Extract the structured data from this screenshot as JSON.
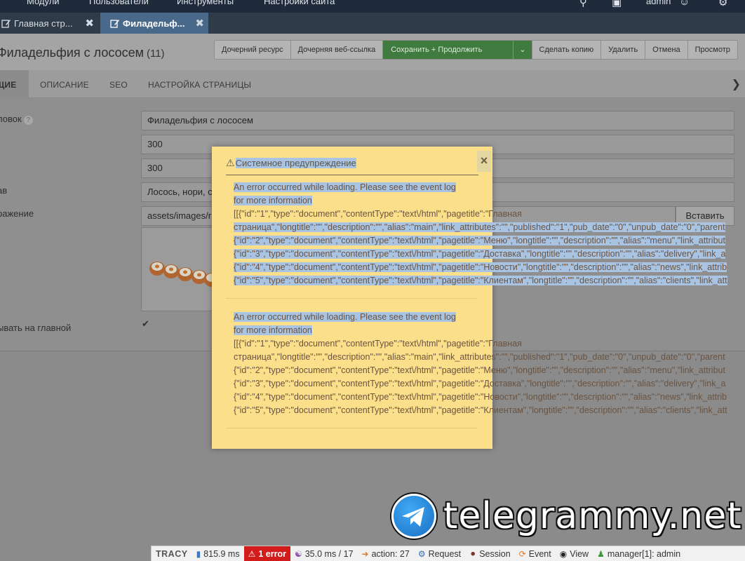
{
  "topnav": {
    "items": [
      "Модули",
      "Пользователи",
      "Инструменты",
      "Настройки сайта"
    ],
    "user": "admin"
  },
  "tabs": [
    {
      "label": "Главная стр...",
      "active": false
    },
    {
      "label": "Филадельф...",
      "active": true
    }
  ],
  "page": {
    "title": "Филадельфия с лососем",
    "count": "(11)"
  },
  "toolbar": {
    "child_resource": "Дочерний ресурс",
    "child_weblink": "Дочерняя веб-ссылка",
    "save_continue": "Сохранить + Продолжить",
    "save_dropdown": "⌄",
    "duplicate": "Сделать копию",
    "delete": "Удалить",
    "cancel": "Отмена",
    "view": "Просмотр"
  },
  "subtabs": {
    "general": "ЩИЕ",
    "description": "ОПИСАНИЕ",
    "seo": "SEO",
    "page_settings": "НАСТРОЙКА СТРАНИЦЫ"
  },
  "form": {
    "title_label": "ловок",
    "title_value": "Филадельфия с лососем",
    "field2_value": "300",
    "field3_value": "300",
    "composition_label": "ав",
    "composition_value": "Лосось, нори, с",
    "image_label": "ражение",
    "image_value": "assets/images/r",
    "insert_button": "Вставить",
    "show_home_label": "ывать на главной"
  },
  "modal": {
    "title": "Системное предупреждение",
    "close": "×",
    "blocks": [
      {
        "lines": [
          "An error occurred while loading. Please see the event log",
          "for more information",
          "[[{\"id\":\"1\",\"type\":\"document\",\"contentType\":\"text\\/html\",\"pagetitle\":\"Главная",
          "страница\",\"longtitle\":\"\",\"description\":\"\",\"alias\":\"main\",\"link_attributes\":\"\",\"published\":\"1\",\"pub_date\":\"0\",\"unpub_date\":\"0\",\"parent",
          "{\"id\":\"2\",\"type\":\"document\",\"contentType\":\"text\\/html\",\"pagetitle\":\"Меню\",\"longtitle\":\"\",\"description\":\"\",\"alias\":\"menu\",\"link_attribut",
          "{\"id\":\"3\",\"type\":\"document\",\"contentType\":\"text\\/html\",\"pagetitle\":\"Доставка\",\"longtitle\":\"\",\"description\":\"\",\"alias\":\"delivery\",\"link_a",
          "{\"id\":\"4\",\"type\":\"document\",\"contentType\":\"text\\/html\",\"pagetitle\":\"Новости\",\"longtitle\":\"\",\"description\":\"\",\"alias\":\"news\",\"link_attrib",
          "{\"id\":\"5\",\"type\":\"document\",\"contentType\":\"text\\/html\",\"pagetitle\":\"Клиентам\",\"longtitle\":\"\",\"description\":\"\",\"alias\":\"clients\",\"link_att"
        ]
      },
      {
        "lines": [
          "An error occurred while loading. Please see the event log",
          "for more information",
          "[[{\"id\":\"1\",\"type\":\"document\",\"contentType\":\"text\\/html\",\"pagetitle\":\"Главная",
          "страница\",\"longtitle\":\"\",\"description\":\"\",\"alias\":\"main\",\"link_attributes\":\"\",\"published\":\"1\",\"pub_date\":\"0\",\"unpub_date\":\"0\",\"parent",
          "{\"id\":\"2\",\"type\":\"document\",\"contentType\":\"text\\/html\",\"pagetitle\":\"Меню\",\"longtitle\":\"\",\"description\":\"\",\"alias\":\"menu\",\"link_attribut",
          "{\"id\":\"3\",\"type\":\"document\",\"contentType\":\"text\\/html\",\"pagetitle\":\"Доставка\",\"longtitle\":\"\",\"description\":\"\",\"alias\":\"delivery\",\"link_a",
          "{\"id\":\"4\",\"type\":\"document\",\"contentType\":\"text\\/html\",\"pagetitle\":\"Новости\",\"longtitle\":\"\",\"description\":\"\",\"alias\":\"news\",\"link_attrib",
          "{\"id\":\"5\",\"type\":\"document\",\"contentType\":\"text\\/html\",\"pagetitle\":\"Клиентам\",\"longtitle\":\"\",\"description\":\"\",\"alias\":\"clients\",\"link_att"
        ]
      }
    ]
  },
  "watermark": {
    "text": "telegrammy.net"
  },
  "tracy": {
    "brand": "TRACY",
    "time": "815.9 ms",
    "errors": "1 error",
    "db": "35.0 ms / 17",
    "action": "action: 27",
    "request": "Request",
    "session": "Session",
    "event": "Event",
    "view": "View",
    "user": "manager[1]: admin"
  },
  "colors": {
    "nav_bg": "#1f2b3a",
    "tab_active": "#49698a",
    "save_green": "#3f7a3f",
    "modal_bg": "#fcdf8a",
    "selection": "#a9c4e3",
    "error_red": "#d21b1b"
  }
}
